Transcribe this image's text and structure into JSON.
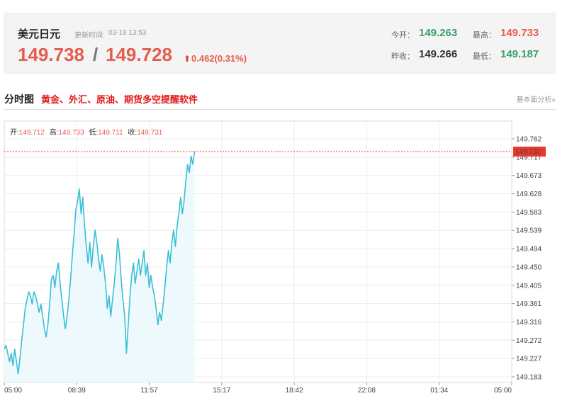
{
  "quote": {
    "name": "美元日元",
    "update_label": "更新时间:",
    "update_time": "03-19 13:53",
    "bid": "149.738",
    "ask": "149.728",
    "change": "0.462(0.31%)",
    "open_label": "今开：",
    "open_value": "149.263",
    "high_label": "最高：",
    "high_value": "149.733",
    "prevclose_label": "昨收：",
    "prevclose_value": "149.266",
    "low_label": "最低：",
    "low_value": "149.187"
  },
  "section": {
    "title": "分时图",
    "link_text": "黄金、外汇、原油、期货多空提醒软件",
    "right_link": "基本面分析»"
  },
  "info": {
    "open_label": "开:",
    "open_value": "149.712",
    "high_label": "高:",
    "high_value": "149.733",
    "low_label": "低:",
    "low_value": "149.711",
    "close_label": "收:",
    "close_value": "149.731"
  },
  "colors": {
    "line": "#3bbfd4",
    "fill": "#eef9fd",
    "up": "#e75c4e",
    "down": "#3aa06a",
    "price_tag": "#e8392b"
  },
  "chart_data": {
    "type": "area",
    "y_ticks": [
      "149.762",
      "149.717",
      "149.673",
      "149.628",
      "149.583",
      "149.539",
      "149.494",
      "149.450",
      "149.405",
      "149.361",
      "149.316",
      "149.272",
      "149.227",
      "149.183"
    ],
    "x_ticks": [
      "05:00",
      "08:39",
      "11:57",
      "15:17",
      "18:42",
      "22:08",
      "01:34",
      "05:00"
    ],
    "ylim": [
      149.183,
      149.762
    ],
    "current_price": "149.731",
    "grid": true,
    "series": [
      {
        "values": [
          149.25,
          149.26,
          149.24,
          149.22,
          149.24,
          149.21,
          149.25,
          149.22,
          149.19,
          149.23,
          149.27,
          149.31,
          149.35,
          149.37,
          149.39,
          149.38,
          149.36,
          149.39,
          149.38,
          149.36,
          149.34,
          149.36,
          149.33,
          149.3,
          149.28,
          149.31,
          149.36,
          149.42,
          149.43,
          149.4,
          149.44,
          149.46,
          149.41,
          149.37,
          149.33,
          149.3,
          149.33,
          149.37,
          149.42,
          149.48,
          149.53,
          149.59,
          149.61,
          149.64,
          149.58,
          149.62,
          149.55,
          149.5,
          149.46,
          149.51,
          149.45,
          149.5,
          149.54,
          149.51,
          149.47,
          149.44,
          149.48,
          149.45,
          149.41,
          149.35,
          149.38,
          149.33,
          149.37,
          149.41,
          149.46,
          149.52,
          149.48,
          149.42,
          149.37,
          149.33,
          149.24,
          149.31,
          149.38,
          149.43,
          149.46,
          149.41,
          149.44,
          149.47,
          149.43,
          149.46,
          149.49,
          149.43,
          149.46,
          149.4,
          149.43,
          149.4,
          149.38,
          149.35,
          149.31,
          149.34,
          149.32,
          149.36,
          149.4,
          149.45,
          149.49,
          149.46,
          149.51,
          149.54,
          149.5,
          149.55,
          149.58,
          149.62,
          149.58,
          149.61,
          149.66,
          149.7,
          149.68,
          149.72,
          149.7,
          149.731
        ]
      }
    ],
    "data_x_fraction": 0.375
  }
}
